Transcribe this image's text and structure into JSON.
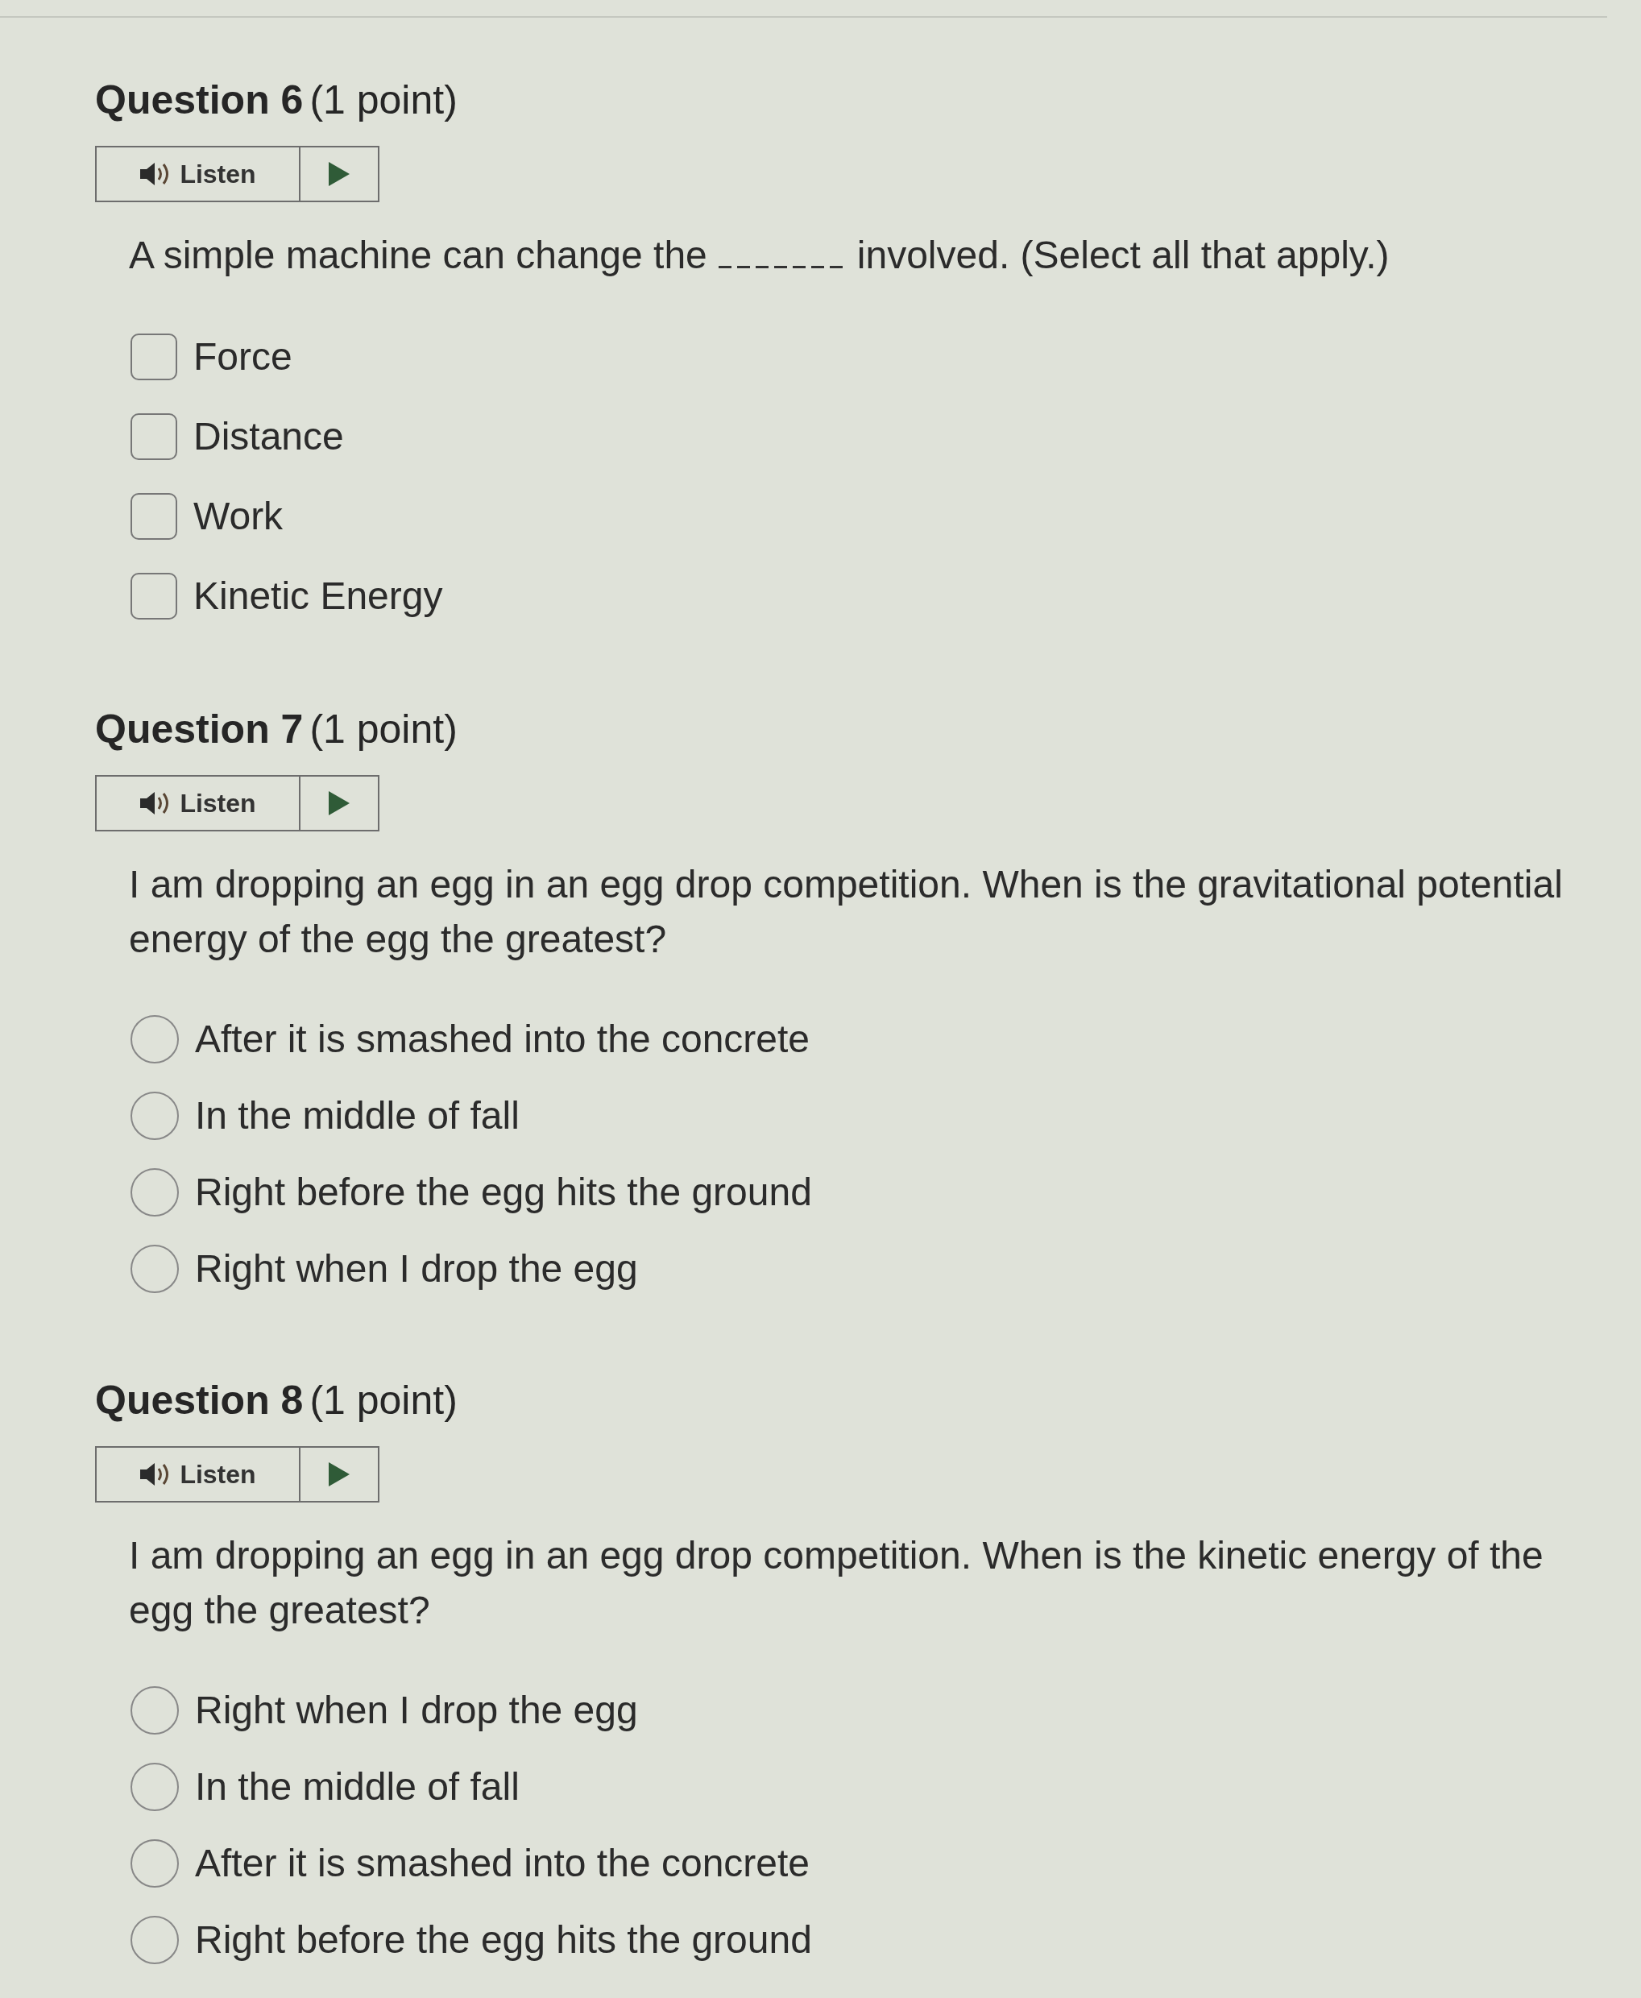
{
  "questions": [
    {
      "title": "Question 6",
      "points": "(1 point)",
      "audio": {
        "label": "Listen"
      },
      "kind": "checkbox",
      "prompt": [
        {
          "kind": "text",
          "text": "A simple machine can change the"
        },
        {
          "kind": "blank"
        },
        {
          "kind": "text",
          "text": "involved. (Select all that apply.)"
        }
      ],
      "options": [
        {
          "label": "Force",
          "checked": false
        },
        {
          "label": "Distance",
          "checked": false
        },
        {
          "label": "Work",
          "checked": false
        },
        {
          "label": "Kinetic Energy",
          "checked": false
        }
      ]
    },
    {
      "title": "Question 7",
      "points": "(1 point)",
      "audio": {
        "label": "Listen"
      },
      "kind": "radio",
      "prompt": [
        {
          "kind": "text",
          "text": "I am dropping an egg in an egg drop competition. When is the gravitational potential energy of the egg the greatest?"
        }
      ],
      "options": [
        {
          "label": "After it is smashed into the concrete",
          "selected": false
        },
        {
          "label": "In the middle of fall",
          "selected": false
        },
        {
          "label": "Right before the egg hits the ground",
          "selected": false
        },
        {
          "label": "Right when I drop the egg",
          "selected": false
        }
      ]
    },
    {
      "title": "Question 8",
      "points": "(1 point)",
      "audio": {
        "label": "Listen"
      },
      "kind": "radio",
      "prompt": [
        {
          "kind": "text",
          "text": "I am dropping an egg in an egg drop competition. When is the kinetic energy of the egg the greatest?"
        }
      ],
      "options": [
        {
          "label": "Right when I drop the egg",
          "selected": false
        },
        {
          "label": "In the middle of fall",
          "selected": false
        },
        {
          "label": "After it is smashed into the concrete",
          "selected": false
        },
        {
          "label": "Right before the egg hits the ground",
          "selected": false
        }
      ]
    }
  ]
}
